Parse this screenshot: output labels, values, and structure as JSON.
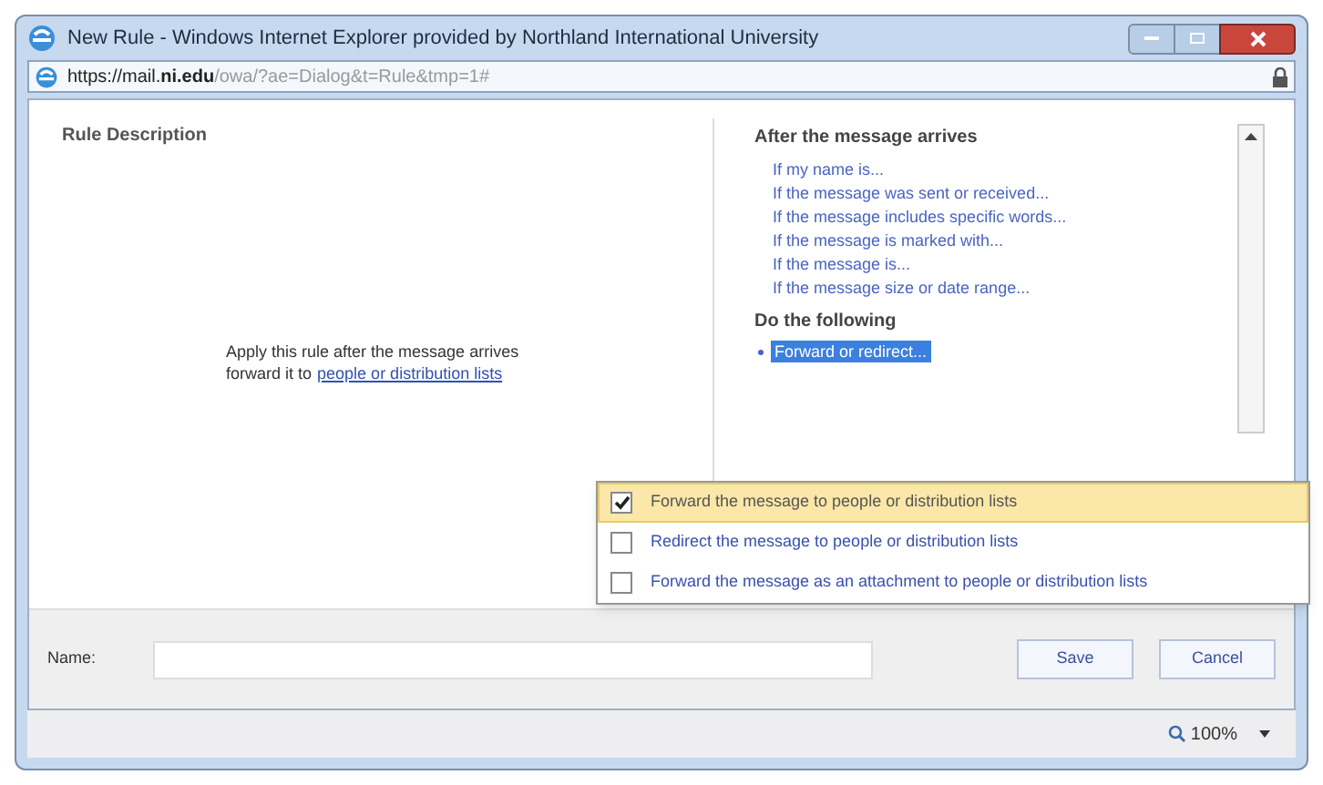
{
  "window": {
    "title": "New Rule - Windows Internet Explorer provided by Northland International University"
  },
  "address": {
    "url_prefix": "https://mail.",
    "url_host": "ni.edu",
    "url_rest": "/owa/?ae=Dialog&t=Rule&tmp=1#"
  },
  "rule_description": {
    "title": "Rule Description",
    "line_1": "Apply this rule after the message arrives",
    "line_2": "forward it to",
    "link": "people or distribution lists"
  },
  "conditions": {
    "heading": "After the message arrives",
    "items": [
      "If my name is...",
      "If the message was sent or received...",
      "If the message includes specific words...",
      "If the message is marked with...",
      "If the message is...",
      "If the message size or date range..."
    ]
  },
  "actions": {
    "heading": "Do the following",
    "items": [
      {
        "label": "Forward or redirect...",
        "selected": true
      }
    ]
  },
  "menu": {
    "items": [
      {
        "label": "Forward the message to people or distribution lists",
        "checked": true,
        "selected": true
      },
      {
        "label": "Redirect the message to people or distribution lists",
        "checked": false,
        "selected": false
      },
      {
        "label": "Forward the message as an attachment to people or distribution lists",
        "checked": false,
        "selected": false
      }
    ]
  },
  "name_field": {
    "label": "Name:"
  },
  "buttons": [
    "Save",
    "Cancel"
  ],
  "status_bar": {
    "zoom": "100%"
  }
}
